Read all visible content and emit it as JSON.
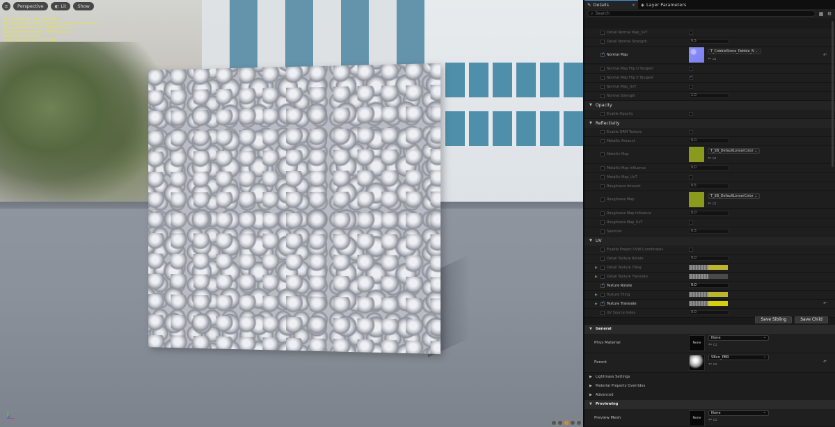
{
  "viewport": {
    "menu_icon": "hamburger-icon",
    "perspective_label": "Perspective",
    "lit_label": "Lit",
    "show_label": "Show",
    "stats": [
      "Base pass shader: 319 instructions",
      "Base pass shader with Surface Lightmap: 351 instructions",
      "Base pass vertex shader: 144 instructions",
      "Base pass vertex shader: 236 instructions",
      "Texture samplers: 9/16",
      "Texture Lookups (Est.): V(0), P(8)"
    ],
    "stats_color": "#e8e63a"
  },
  "panel": {
    "tabs": [
      {
        "label": "Details",
        "icon": "pencil-icon",
        "close": "×"
      },
      {
        "label": "Layer Parameters",
        "icon": "layers-icon"
      }
    ],
    "search_placeholder": "Search",
    "accent": "#3d8fd6",
    "rows": {
      "detail_normal_uvt": "Detail Normal Map_UvT",
      "detail_normal_strength": "Detail Normal Strength",
      "detail_normal_strength_val": "0.5",
      "normal_map": "Normal Map",
      "normal_map_asset": "T_CobbleStone_Pebble_N",
      "normal_flip_u": "Normal Map Flip U Tangent",
      "normal_flip_v": "Normal Map Flip V Tangent",
      "normal_uvt": "Normal Map_UvT",
      "normal_strength": "Normal Strength",
      "normal_strength_val": "1.0",
      "opacity_section": "Opacity",
      "enable_opacity": "Enable Opacity",
      "reflectivity_section": "Reflectivity",
      "enable_orm": "Enable ORM Texture",
      "metallic_amount": "Metallic Amount",
      "metallic_amount_val": "0.0",
      "metallic_map": "Metallic Map",
      "metallic_map_asset": "T_SB_DefaultLinearColor",
      "metallic_map_influence": "Metallic Map Influence",
      "metallic_map_influence_val": "0.0",
      "metallic_uvt": "Metallic Map_UvT",
      "roughness_amount": "Roughness Amount",
      "roughness_amount_val": "0.5",
      "roughness_map": "Roughness Map",
      "roughness_map_asset": "T_SB_DefaultLinearColor",
      "roughness_influence": "Roughness Map Influence",
      "roughness_influence_val": "0.0",
      "roughness_uvt": "Roughness Map_UvT",
      "specular": "Specular",
      "specular_val": "0.5",
      "uv_section": "UV",
      "enable_project_uvw": "Enable Project UVW Coordinates",
      "detail_texture_rotate": "Detail Texture Rotate",
      "detail_texture_rotate_val": "0.0",
      "detail_texture_tiling": "Detail Texture Tiling",
      "detail_texture_translate": "Detail Texture Translate",
      "texture_rotate": "Texture Rotate",
      "texture_rotate_val": "0.0",
      "texture_tiling": "Texture Tiling",
      "texture_translate": "Texture Translate",
      "uv_source_index": "UV Source Index",
      "uv_source_index_val": "0.0"
    },
    "save_sibling": "Save Sibling",
    "save_child": "Save Child",
    "general_section": "General",
    "phys_material_label": "Phys Material",
    "phys_material_thumb": "None",
    "phys_material_value": "None",
    "parent_label": "Parent",
    "parent_value": "SBco_PBR",
    "lightmass_section": "Lightmass Settings",
    "material_overrides_section": "Material Property Overrides",
    "advanced_section": "Advanced",
    "previewing_section": "Previewing",
    "preview_mesh_label": "Preview Mesh",
    "preview_mesh_thumb": "None",
    "preview_mesh_value": "None",
    "icons": {
      "reset": "reset-arrow-icon",
      "browse": "browse-icon",
      "use": "use-selected-icon",
      "grid": "grid-icon",
      "settings": "gear-icon"
    }
  }
}
